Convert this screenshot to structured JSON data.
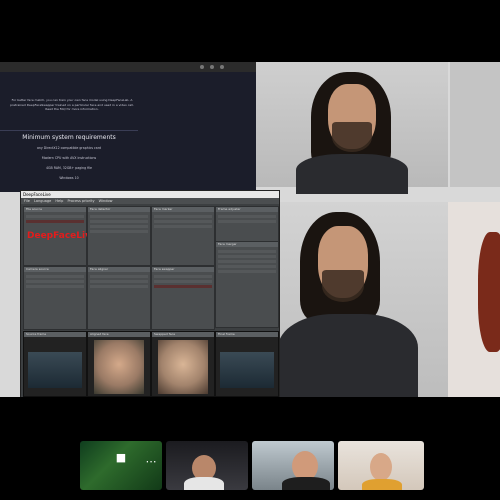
{
  "web": {
    "intro_text": "For better face match, you can train your own face model using DeepFaceLab. A pretrained DeepFaceSwapper trained on a particular face and used in a video call. Read the FAQ for more information.",
    "heading": "Minimum system requirements",
    "requirements": [
      "any DirectX12 compatible graphics card",
      "Modern CPU with AVX instructions",
      "4GB RAM, 32GB+ paging file",
      "Windows 10"
    ]
  },
  "app": {
    "window_title": "DeepFaceLive",
    "menu": [
      "File",
      "Language",
      "Help",
      "Process priority",
      "Window"
    ],
    "logo_text": "DeepFaceLive",
    "nodes": [
      {
        "title": "File source"
      },
      {
        "title": "Face detector"
      },
      {
        "title": "Face marker"
      },
      {
        "title": "Face aligner"
      },
      {
        "title": "Face swapper"
      },
      {
        "title": "Frame adjuster"
      },
      {
        "title": "Face merger"
      },
      {
        "title": "Stream output"
      },
      {
        "title": "Camera source"
      }
    ],
    "previews": [
      "Source frame",
      "Aligned face",
      "Swapped face",
      "Final frame"
    ]
  },
  "call": {
    "participants": [
      "",
      "",
      "",
      ""
    ],
    "toolbar_icons": [
      "video-icon",
      "more-icon"
    ]
  }
}
